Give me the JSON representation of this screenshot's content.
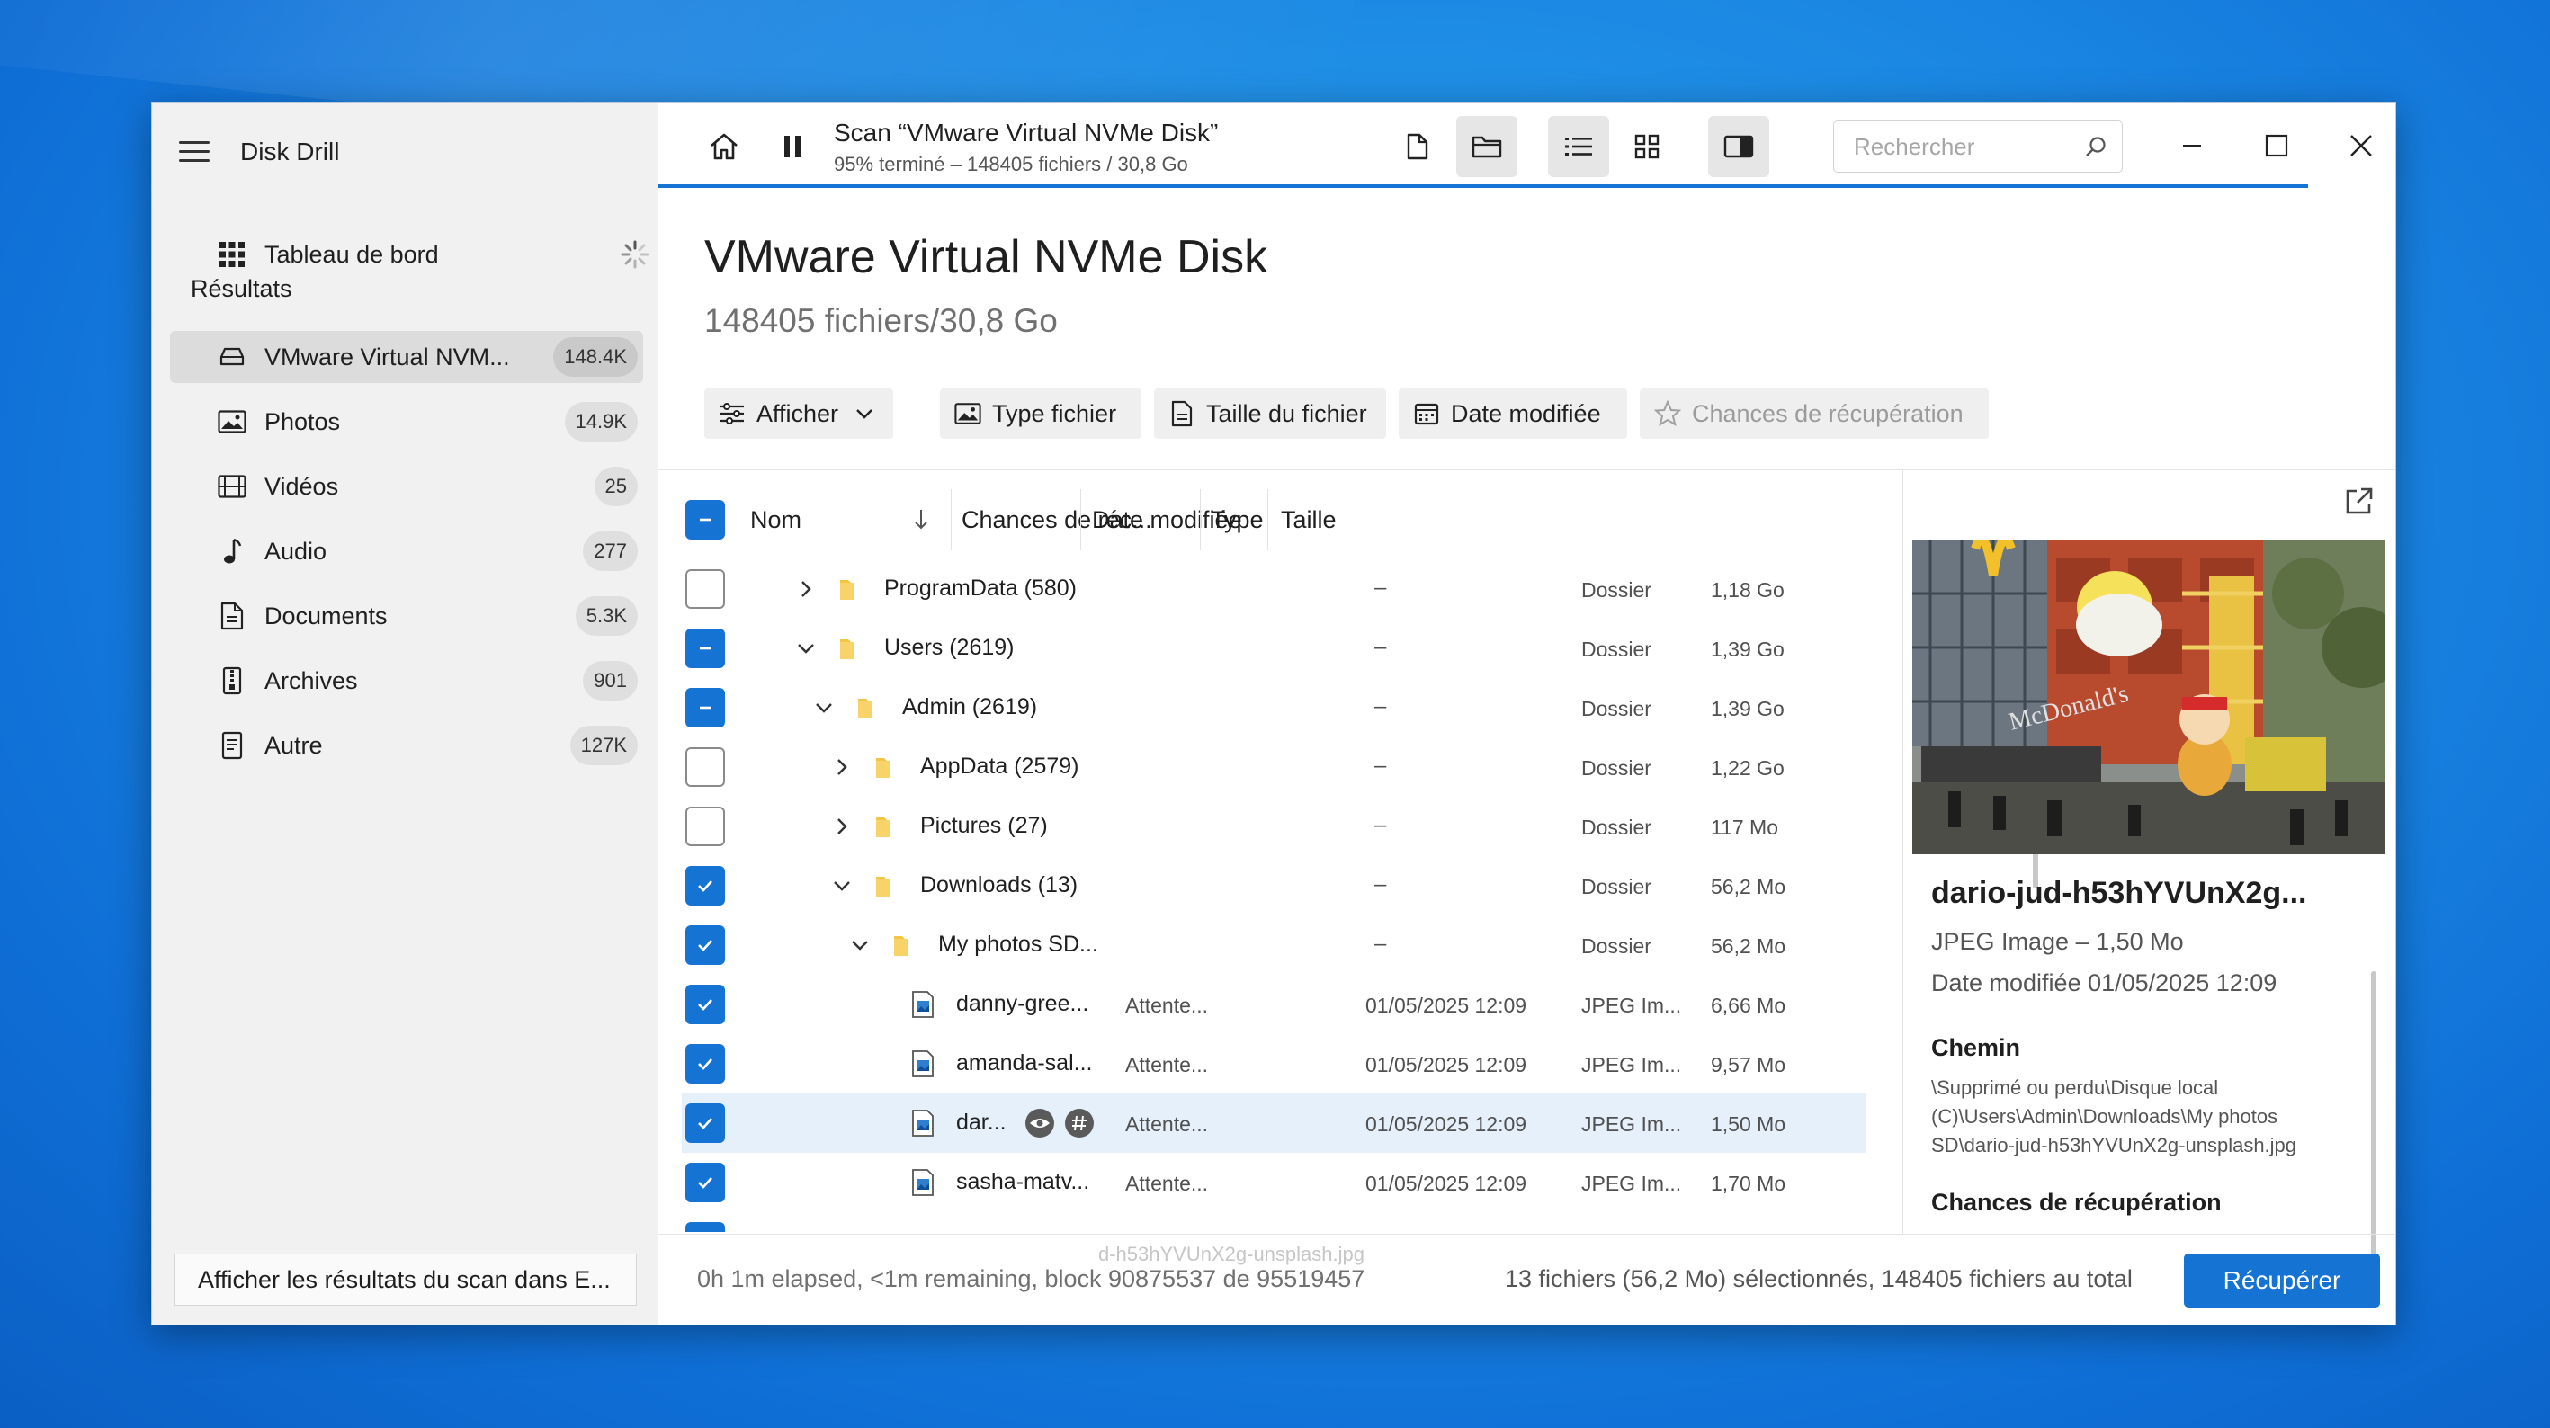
{
  "app": {
    "title": "Disk Drill"
  },
  "sidebar": {
    "dashboard_label": "Tableau de bord",
    "section_label": "Résultats",
    "items": [
      {
        "label": "VMware Virtual NVM...",
        "count": "148.4K",
        "icon": "drive-icon"
      },
      {
        "label": "Photos",
        "count": "14.9K",
        "icon": "image-icon"
      },
      {
        "label": "Vidéos",
        "count": "25",
        "icon": "film-icon"
      },
      {
        "label": "Audio",
        "count": "277",
        "icon": "music-icon"
      },
      {
        "label": "Documents",
        "count": "5.3K",
        "icon": "document-icon"
      },
      {
        "label": "Archives",
        "count": "901",
        "icon": "archive-icon"
      },
      {
        "label": "Autre",
        "count": "127K",
        "icon": "other-file-icon"
      }
    ],
    "footer_button": "Afficher les résultats du scan dans E..."
  },
  "topbar": {
    "scan_title": "Scan “VMware Virtual NVMe Disk”",
    "scan_subtitle": "95% terminé – 148405 fichiers / 30,8 Go",
    "search_placeholder": "Rechercher",
    "progress_fraction": 0.95
  },
  "header": {
    "disk_title": "VMware Virtual NVMe Disk",
    "disk_subtitle": "148405 fichiers/30,8 Go"
  },
  "filters": {
    "show": "Afficher",
    "file_type": "Type fichier",
    "file_size": "Taille du fichier",
    "date_modified": "Date modifiée",
    "recovery_chances": "Chances de récupération"
  },
  "table": {
    "columns": {
      "name": "Nom",
      "chances": "Chances de réc...",
      "date": "Date modifiée",
      "type": "Type",
      "size": "Taille"
    },
    "rows": [
      {
        "name": "ProgramData (580)",
        "chances": "",
        "date": "–",
        "type": "Dossier",
        "size": "1,18 Go",
        "state": "off",
        "expanded": false,
        "kind": "folder",
        "level": 0
      },
      {
        "name": "Users (2619)",
        "chances": "",
        "date": "–",
        "type": "Dossier",
        "size": "1,39 Go",
        "state": "partial",
        "expanded": true,
        "kind": "folder",
        "level": 0
      },
      {
        "name": "Admin (2619)",
        "chances": "",
        "date": "–",
        "type": "Dossier",
        "size": "1,39 Go",
        "state": "partial",
        "expanded": true,
        "kind": "folder",
        "level": 1
      },
      {
        "name": "AppData (2579)",
        "chances": "",
        "date": "–",
        "type": "Dossier",
        "size": "1,22 Go",
        "state": "off",
        "expanded": false,
        "kind": "folder",
        "level": 2
      },
      {
        "name": "Pictures (27)",
        "chances": "",
        "date": "–",
        "type": "Dossier",
        "size": "117 Mo",
        "state": "off",
        "expanded": false,
        "kind": "folder",
        "level": 2
      },
      {
        "name": "Downloads (13)",
        "chances": "",
        "date": "–",
        "type": "Dossier",
        "size": "56,2 Mo",
        "state": "on",
        "expanded": true,
        "kind": "folder",
        "level": 2
      },
      {
        "name": "My photos SD...",
        "chances": "",
        "date": "–",
        "type": "Dossier",
        "size": "56,2 Mo",
        "state": "on",
        "expanded": true,
        "kind": "folder",
        "level": 3
      },
      {
        "name": "danny-gree...",
        "chances": "Attente...",
        "date": "01/05/2025 12:09",
        "type": "JPEG Im...",
        "size": "6,66 Mo",
        "state": "on",
        "kind": "image",
        "level": 4
      },
      {
        "name": "amanda-sal...",
        "chances": "Attente...",
        "date": "01/05/2025 12:09",
        "type": "JPEG Im...",
        "size": "9,57 Mo",
        "state": "on",
        "kind": "image",
        "level": 4
      },
      {
        "name": "dar...",
        "chances": "Attente...",
        "date": "01/05/2025 12:09",
        "type": "JPEG Im...",
        "size": "1,50 Mo",
        "state": "on",
        "kind": "image",
        "level": 4,
        "selected": true
      },
      {
        "name": "sasha-matv...",
        "chances": "Attente...",
        "date": "01/05/2025 12:09",
        "type": "JPEG Im...",
        "size": "1,70 Mo",
        "state": "on",
        "kind": "image",
        "level": 4
      }
    ],
    "tooltip": "d-h53hYVUnX2g-unsplash.jpg"
  },
  "preview": {
    "file_name": "dario-jud-h53hYVUnX2g...",
    "file_type": "JPEG Image – 1,50 Mo",
    "date_modified": "Date modifiée 01/05/2025 12:09",
    "path_label": "Chemin",
    "path_value": "\\Supprimé ou perdu\\Disque local (C)\\Users\\Admin\\Downloads\\My photos SD\\dario-jud-h53hYVUnX2g-unsplash.jpg",
    "recovery_label": "Chances de récupération",
    "photo_sign": "McDonald's"
  },
  "statusbar": {
    "progress_text": "0h 1m elapsed, <1m remaining, block 90875537 de 95519457",
    "selection_summary": "13 fichiers (56,2 Mo) sélectionnés, 148405 fichiers au total",
    "recover_button": "Récupérer"
  },
  "colors": {
    "accent": "#1573d3",
    "selected_row": "#e5f0fb",
    "folder": "#f4c542"
  }
}
